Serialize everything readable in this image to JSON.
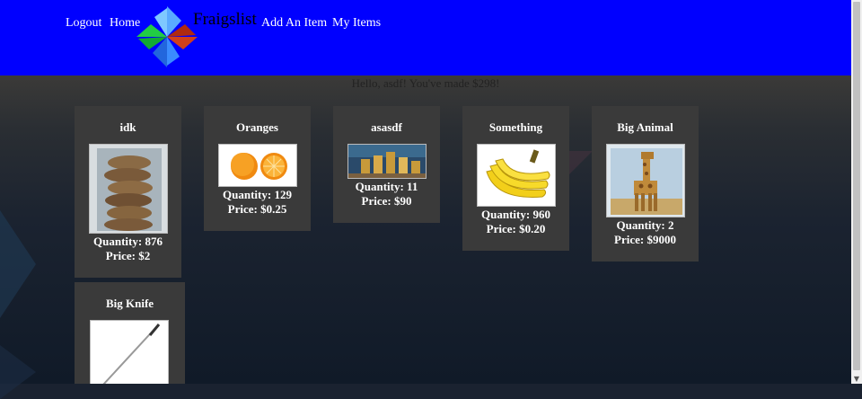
{
  "header": {
    "nav": [
      "Logout",
      "Home",
      "Add An Item",
      "My Items"
    ],
    "logo_text": "Fraigslist"
  },
  "greeting": "Hello, asdf! You've made $298!",
  "items": [
    {
      "title": "idk",
      "quantity": "Quantity: 876",
      "price": "Price: $2",
      "image": "cookies-stack-image"
    },
    {
      "title": "Oranges",
      "quantity": "Quantity: 129",
      "price": "Price: $0.25",
      "image": "oranges-image"
    },
    {
      "title": "asasdf",
      "quantity": "Quantity: 11",
      "price": "Price: $90",
      "image": "coins-image"
    },
    {
      "title": "Something",
      "quantity": "Quantity: 960",
      "price": "Price: $0.20",
      "image": "bananas-image"
    },
    {
      "title": "Big Animal",
      "quantity": "Quantity: 2",
      "price": "Price: $9000",
      "image": "giraffe-image"
    },
    {
      "title": "Big Knife",
      "quantity": "",
      "price": "",
      "image": "knife-image"
    }
  ],
  "colors": {
    "header_bg": "#0000ff",
    "card_bg": "#3a3a3a",
    "text": "#ffffff"
  }
}
